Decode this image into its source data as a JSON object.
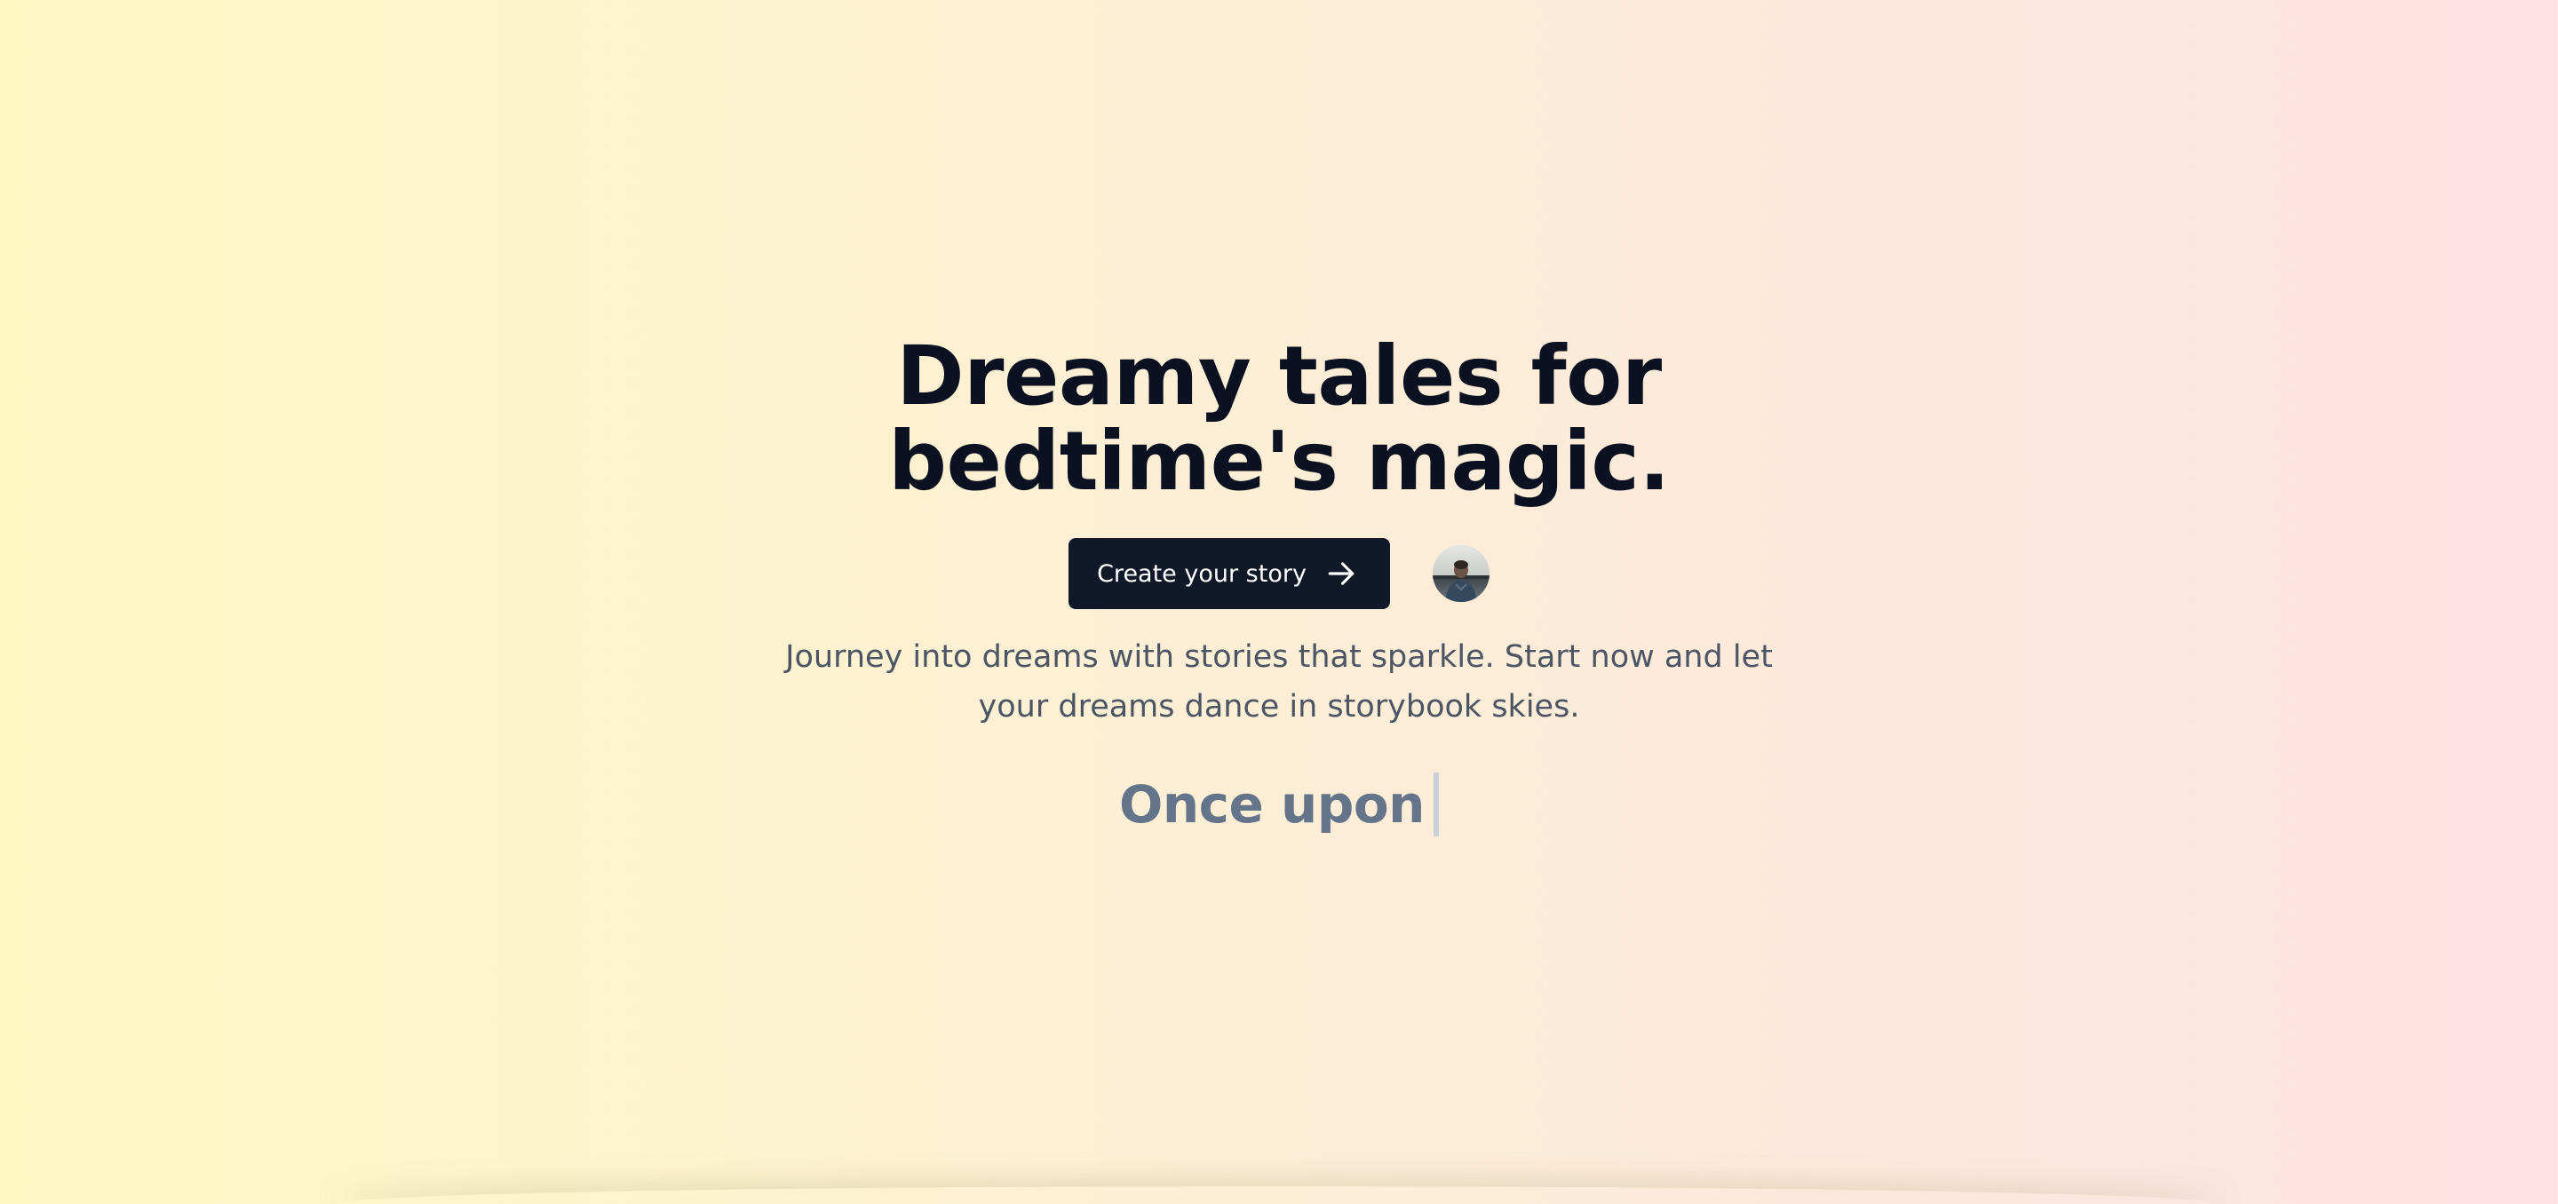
{
  "hero": {
    "headline": "Dreamy tales for bedtime's magic.",
    "cta_label": "Create your story",
    "cta_icon": "arrow-right-icon",
    "avatar_icon": "user-avatar",
    "subtext": "Journey into dreams with stories that sparkle. Start now and let your dreams dance in storybook skies.",
    "typing_text": "Once upon"
  },
  "colors": {
    "background_left": "#fef9c3",
    "background_right": "#fde2e4",
    "headline": "#0b1120",
    "button_bg": "#111827",
    "button_text": "#ffffff",
    "subtext": "#4b5563",
    "typing_text": "#64748b",
    "caret": "#cbd0d8"
  }
}
